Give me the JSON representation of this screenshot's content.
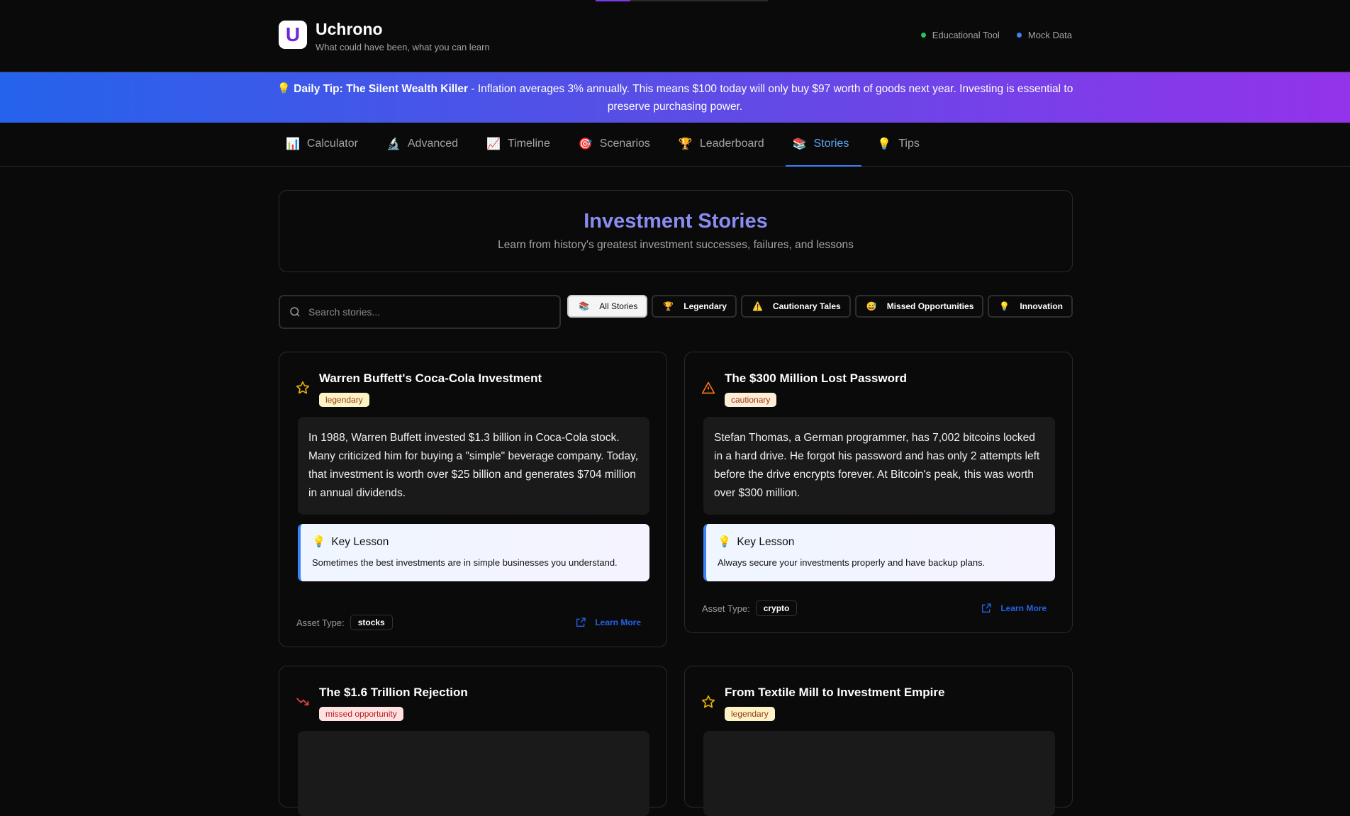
{
  "header": {
    "logo_letter": "U",
    "title": "Uchrono",
    "subtitle": "What could have been, what you can learn",
    "badges": [
      {
        "label": "Educational Tool",
        "color": "#22c55e"
      },
      {
        "label": "Mock Data",
        "color": "#3b82f6"
      }
    ]
  },
  "banner": {
    "icon": "💡",
    "title": "Daily Tip: The Silent Wealth Killer",
    "text": " - Inflation averages 3% annually. This means $100 today will only buy $97 worth of goods next year. Investing is essential to preserve purchasing power."
  },
  "nav": {
    "tabs": [
      {
        "icon": "📊",
        "label": "Calculator"
      },
      {
        "icon": "🔬",
        "label": "Advanced"
      },
      {
        "icon": "📈",
        "label": "Timeline"
      },
      {
        "icon": "🎯",
        "label": "Scenarios"
      },
      {
        "icon": "🏆",
        "label": "Leaderboard"
      },
      {
        "icon": "📚",
        "label": "Stories",
        "active": true
      },
      {
        "icon": "💡",
        "label": "Tips"
      }
    ]
  },
  "hero": {
    "title": "Investment Stories",
    "subtitle": "Learn from history's greatest investment successes, failures, and lessons"
  },
  "search": {
    "placeholder": "Search stories...",
    "value": ""
  },
  "filters": [
    {
      "icon": "📚",
      "label": "All Stories",
      "active": true
    },
    {
      "icon": "🏆",
      "label": "Legendary"
    },
    {
      "icon": "⚠️",
      "label": "Cautionary Tales"
    },
    {
      "icon": "😅",
      "label": "Missed Opportunities"
    },
    {
      "icon": "💡",
      "label": "Innovation"
    }
  ],
  "lesson_heading": "Key Lesson",
  "asset_label": "Asset Type:",
  "learn_more": "Learn More",
  "stories": [
    {
      "icon": "star-icon",
      "title": "Warren Buffett's Coca-Cola Investment",
      "tag": "legendary",
      "text": "In 1988, Warren Buffett invested $1.3 billion in Coca-Cola stock. Many criticized him for buying a \"simple\" beverage company. Today, that investment is worth over $25 billion and generates $704 million in annual dividends.",
      "lesson": "Sometimes the best investments are in simple businesses you understand.",
      "asset": "stocks"
    },
    {
      "icon": "warning-icon",
      "title": "The $300 Million Lost Password",
      "tag": "cautionary",
      "text": "Stefan Thomas, a German programmer, has 7,002 bitcoins locked in a hard drive. He forgot his password and has only 2 attempts left before the drive encrypts forever. At Bitcoin's peak, this was worth over $300 million.",
      "lesson": "Always secure your investments properly and have backup plans.",
      "asset": "crypto"
    },
    {
      "icon": "trending-down-icon",
      "title": "The $1.6 Trillion Rejection",
      "tag": "missed opportunity"
    },
    {
      "icon": "star-icon",
      "title": "From Textile Mill to Investment Empire",
      "tag": "legendary"
    }
  ]
}
